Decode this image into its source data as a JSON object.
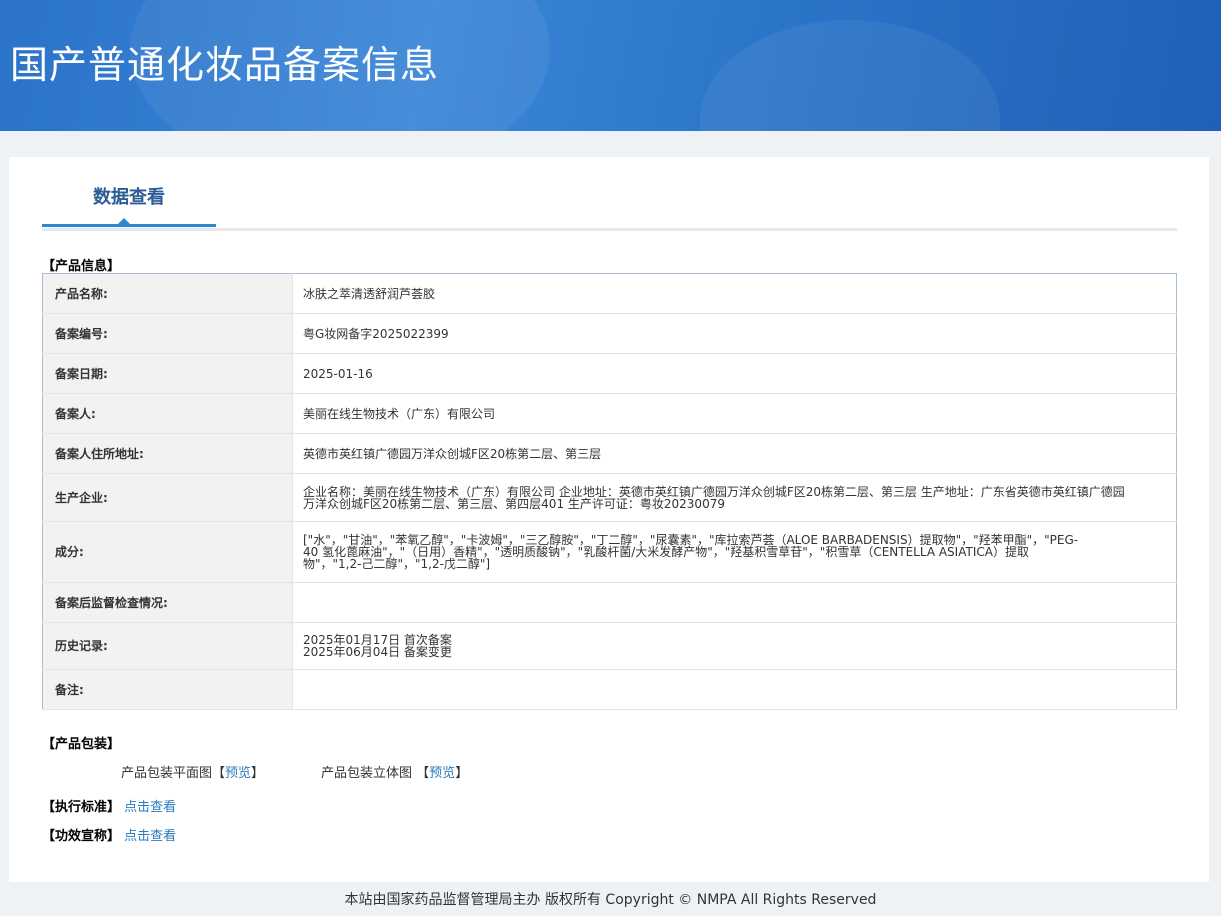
{
  "header": {
    "title": "国产普通化妆品备案信息"
  },
  "tab": {
    "label": "数据查看"
  },
  "product_info": {
    "section_title": "【产品信息】",
    "rows": [
      {
        "label": "产品名称:",
        "value": "冰肤之萃清透舒润芦荟胶"
      },
      {
        "label": "备案编号:",
        "value": "粤G妆网备字2025022399"
      },
      {
        "label": "备案日期:",
        "value": "2025-01-16"
      },
      {
        "label": "备案人:",
        "value": "美丽在线生物技术（广东）有限公司"
      },
      {
        "label": "备案人住所地址:",
        "value": "英德市英红镇广德园万洋众创城F区20栋第二层、第三层"
      },
      {
        "label": "生产企业:",
        "value": "企业名称：美丽在线生物技术（广东）有限公司 企业地址：英德市英红镇广德园万洋众创城F区20栋第二层、第三层 生产地址：广东省英德市英红镇广德园万洋众创城F区20栋第二层、第三层、第四层401 生产许可证：粤妆20230079"
      },
      {
        "label": "成分:",
        "value": "[\"水\"，\"甘油\"，\"苯氧乙醇\"，\"卡波姆\"，\"三乙醇胺\"，\"丁二醇\"，\"尿囊素\"，\"库拉索芦荟（ALOE BARBADENSIS）提取物\"，\"羟苯甲酯\"，\"PEG-40 氢化蓖麻油\"，\"（日用）香精\"，\"透明质酸钠\"，\"乳酸杆菌/大米发酵产物\"，\"羟基积雪草苷\"，\"积雪草（CENTELLA ASIATICA）提取物\"，\"1,2-己二醇\"，\"1,2-戊二醇\"]"
      },
      {
        "label": "备案后监督检查情况:",
        "value": ""
      },
      {
        "label": "历史记录:",
        "value": "",
        "history": [
          "2025年01月17日 首次备案",
          "2025年06月04日 备案变更"
        ]
      },
      {
        "label": "备注:",
        "value": ""
      }
    ]
  },
  "packaging": {
    "section_title": "【产品包装】",
    "flat_label": "产品包装平面图",
    "solid_label": "产品包装立体图",
    "preview": "预览",
    "lb": "【",
    "rb": "】"
  },
  "standard": {
    "section_title": "【执行标准】",
    "link": "点击查看"
  },
  "efficacy": {
    "section_title": "【功效宣称】",
    "link": "点击查看"
  },
  "footer": {
    "text": "本站由国家药品监督管理局主办 版权所有 Copyright © NMPA All Rights Reserved"
  }
}
